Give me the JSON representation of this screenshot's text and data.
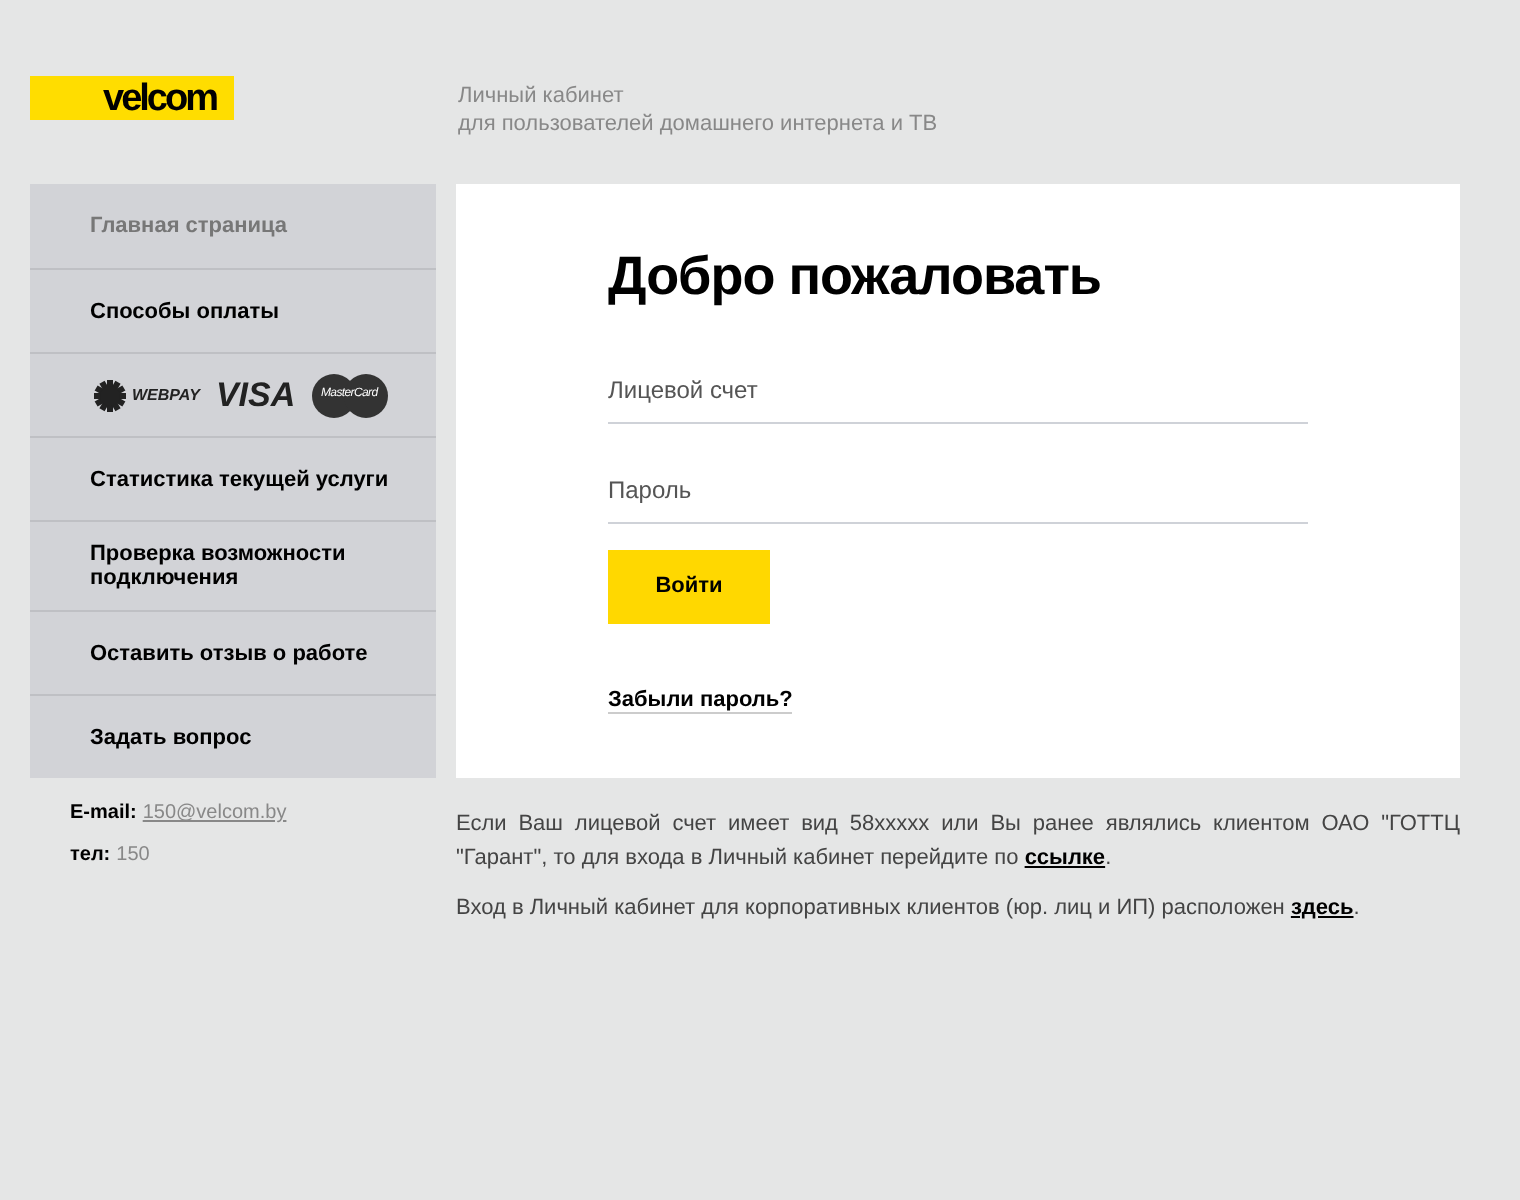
{
  "logo": {
    "text": "velcom"
  },
  "header": {
    "title": "Личный кабинет",
    "subtitle": "для пользователей домашнего интернета и ТВ"
  },
  "sidebar": {
    "items": [
      {
        "kind": "link",
        "label": "Главная страница",
        "selected": true
      },
      {
        "kind": "link",
        "label": "Способы оплаты",
        "selected": false
      },
      {
        "kind": "logos",
        "logos": [
          {
            "kind": "webpay",
            "text": "WEBPAY"
          },
          {
            "kind": "visa",
            "text": "VISA"
          },
          {
            "kind": "mastercard",
            "text": "MasterCard"
          }
        ]
      },
      {
        "kind": "link",
        "label": "Статистика текущей услуги",
        "selected": false
      },
      {
        "kind": "link",
        "label": "Проверка возможности подключения",
        "selected": false
      },
      {
        "kind": "link",
        "label": "Оставить отзыв о работе",
        "selected": false
      },
      {
        "kind": "link",
        "label": "Задать вопрос",
        "selected": false
      }
    ]
  },
  "contacts": [
    {
      "kind": "email",
      "label": "E-mail:",
      "value": "150@velcom.by"
    },
    {
      "kind": "phone",
      "label": "тел:",
      "value": "150"
    }
  ],
  "login": {
    "title": "Добро пожаловать",
    "fields": [
      {
        "placeholder": "Лицевой счет"
      },
      {
        "placeholder": "Пароль"
      }
    ],
    "button": "Войти",
    "forgot": "Забыли пароль?"
  },
  "notes": [
    {
      "before": "Если Ваш лицевой счет имеет вид 58xxxxx или Вы ранее являлись клиентом ОАО \"ГОТТЦ \"Гарант\", то для входа в Личный кабинет перейдите по ",
      "link": "ссылке",
      "after": "."
    },
    {
      "before": "Вход в Личный кабинет для корпоративных клиентов (юр. лиц и ИП) расположен ",
      "link": "здесь",
      "after": "."
    }
  ]
}
